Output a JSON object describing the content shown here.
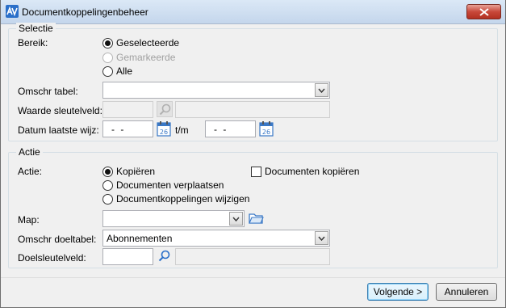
{
  "window": {
    "title": "Documentkoppelingenbeheer"
  },
  "selectie": {
    "legend": "Selectie",
    "bereik_label": "Bereik:",
    "radios": {
      "geselecteerde": "Geselecteerde",
      "gemarkeerde": "Gemarkeerde",
      "alle": "Alle"
    },
    "selected": "Geselecteerde",
    "omschr_tabel_label": "Omschr tabel:",
    "omschr_tabel_value": "",
    "waarde_label": "Waarde sleutelveld:",
    "datum_label": "Datum laatste wijz:",
    "datum_from": "- -",
    "datum_to": "- -",
    "tm_label": "t/m"
  },
  "actie": {
    "legend": "Actie",
    "actie_label": "Actie:",
    "radios": {
      "kopieren": "Kopiëren",
      "verplaatsen": "Documenten verplaatsen",
      "wijzigen": "Documentkoppelingen wijzigen"
    },
    "selected": "Kopiëren",
    "checkbox_label": "Documenten kopiëren",
    "checkbox_checked": false,
    "map_label": "Map:",
    "map_value": "",
    "doeltabel_label": "Omschr doeltabel:",
    "doeltabel_value": "Abonnementen",
    "doelsleutel_label": "Doelsleutelveld:",
    "doelsleutel_value": ""
  },
  "footer": {
    "next_label": "Volgende >",
    "cancel_label": "Annuleren"
  },
  "calendar_icon_text": "26",
  "colors": {
    "accent": "#2a6fc9",
    "close": "#c8483a",
    "calendar": "#3a78c6"
  }
}
